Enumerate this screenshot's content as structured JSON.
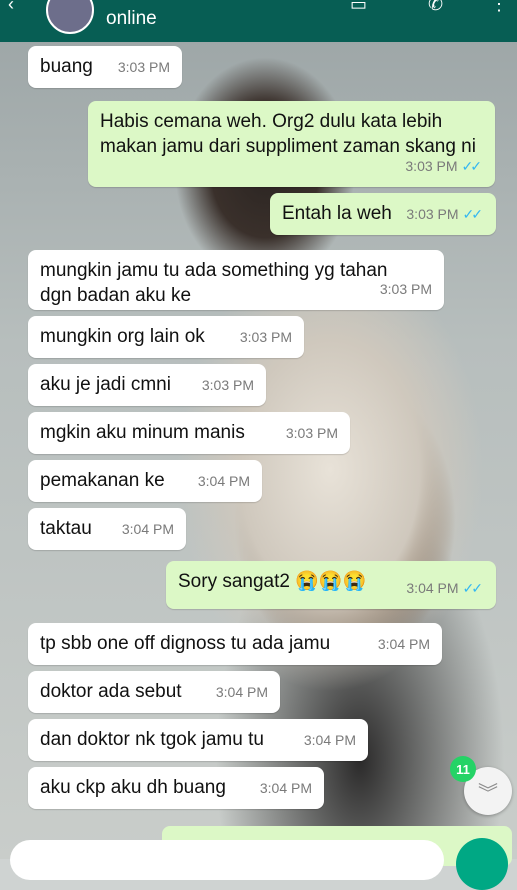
{
  "header": {
    "status": "online"
  },
  "messages": [
    {
      "text": "buang",
      "time": "3:03 PM",
      "dir": "in"
    },
    {
      "text": "Habis cemana weh. Org2 dulu kata lebih makan jamu dari suppliment zaman skang ni",
      "time": "3:03 PM",
      "dir": "out"
    },
    {
      "text": "Entah la weh",
      "time": "3:03 PM",
      "dir": "out"
    },
    {
      "text": "mungkin jamu tu ada something yg tahan dgn badan aku ke",
      "time": "3:03 PM",
      "dir": "in"
    },
    {
      "text": "mungkin org lain ok",
      "time": "3:03 PM",
      "dir": "in"
    },
    {
      "text": "aku je jadi cmni",
      "time": "3:03 PM",
      "dir": "in"
    },
    {
      "text": "mgkin aku minum manis",
      "time": "3:03 PM",
      "dir": "in"
    },
    {
      "text": "pemakanan ke",
      "time": "3:04 PM",
      "dir": "in"
    },
    {
      "text": "taktau",
      "time": "3:04 PM",
      "dir": "in"
    },
    {
      "text": "Sory sangat2 😭😭😭",
      "time": "3:04 PM",
      "dir": "out"
    },
    {
      "text": "tp sbb one off dignoss tu ada jamu",
      "time": "3:04 PM",
      "dir": "in"
    },
    {
      "text": "doktor ada sebut",
      "time": "3:04 PM",
      "dir": "in"
    },
    {
      "text": "dan doktor nk tgok jamu tu",
      "time": "3:04 PM",
      "dir": "in"
    },
    {
      "text": "aku ckp aku dh buang",
      "time": "3:04 PM",
      "dir": "in"
    }
  ],
  "unread_badge": "11",
  "icons": {
    "back": "arrow-left-icon",
    "video": "video-call-icon",
    "call": "phone-icon",
    "menu": "more-vert-icon",
    "scroll": "chevron-down-double-icon"
  },
  "colors": {
    "header": "#075e54",
    "outgoing": "#dcf8c6",
    "incoming": "#ffffff",
    "ticks": "#34b7f1",
    "badge": "#25d366"
  }
}
